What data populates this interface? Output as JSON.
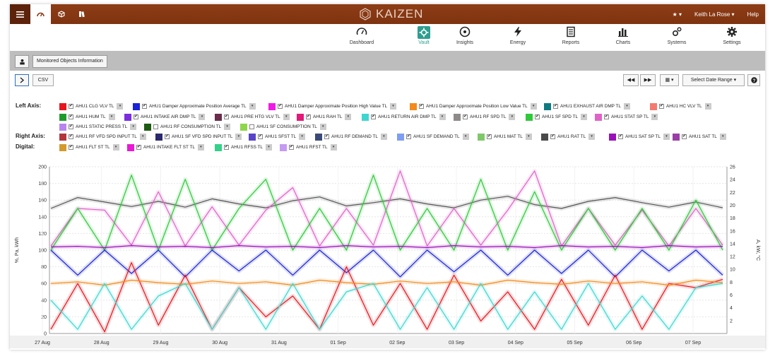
{
  "brand": {
    "name": "KAIZEN"
  },
  "topbar": {
    "user": "Keith La Rose",
    "help": "Help"
  },
  "nav": [
    {
      "label": "Dashboard",
      "icon": "gauge-icon"
    },
    {
      "label": "Vault",
      "icon": "gear-vault-icon",
      "active": true
    },
    {
      "label": "Insights",
      "icon": "insights-icon"
    },
    {
      "label": "Energy",
      "icon": "bolt-icon"
    },
    {
      "label": "Reports",
      "icon": "document-icon"
    },
    {
      "label": "Charts",
      "icon": "bar-chart-icon"
    },
    {
      "label": "Systems",
      "icon": "gears-icon"
    },
    {
      "label": "Settings",
      "icon": "cog-icon"
    }
  ],
  "strip": {
    "monitored": "Monitored Objects Information"
  },
  "toolbar": {
    "csv": "CSV",
    "date_range": "Select Date Range"
  },
  "legend": {
    "left_axis_label": "Left Axis:",
    "right_axis_label": "Right Axis:",
    "digital_label": "Digital:",
    "left": [
      {
        "name": "AHU1 CLG VLV TL",
        "color": "#e8141c",
        "checked": true
      },
      {
        "name": "AHU1 Damper Approximate Position Average TL",
        "color": "#1a23d6",
        "checked": true
      },
      {
        "name": "AHU1 Damper Approximate Position High Value TL",
        "color": "#f219e6",
        "checked": true
      },
      {
        "name": "AHU1 Damper Approximate Position Low Value TL",
        "color": "#f38a1c",
        "checked": true
      },
      {
        "name": "AHU1 EXHAUST AIR DMP TL",
        "color": "#0f7a82",
        "checked": true
      },
      {
        "name": "AHU1 HC VLV TL",
        "color": "#f47a70",
        "checked": true
      },
      {
        "name": "AHU1 HUM TL",
        "color": "#1f9b2c",
        "checked": true
      },
      {
        "name": "AHU1 INTAKE AIR DMP TL",
        "color": "#7b2ee0",
        "checked": true
      },
      {
        "name": "AHU1 PRE HTG VLV TL",
        "color": "#6a2d4a",
        "checked": true
      },
      {
        "name": "AHU1 RAH TL",
        "color": "#e21a78",
        "checked": true
      },
      {
        "name": "AHU1 RETURN AIR DMP TL",
        "color": "#3fd6cf",
        "checked": true
      },
      {
        "name": "AHU1 RF SPD TL",
        "color": "#8e8a8a",
        "checked": true
      },
      {
        "name": "AHU1 SF SPD TL",
        "color": "#2fc93a",
        "checked": true
      },
      {
        "name": "AHU1 STAT SP TL",
        "color": "#e063c7",
        "checked": true
      },
      {
        "name": "AHU1 STATIC PRESS TL",
        "color": "#b784f0",
        "checked": true
      },
      {
        "name": "AHU1 RF CONSUMPTION TL",
        "color": "#1d5a12",
        "checked": false
      },
      {
        "name": "AHU1 SF CONSUMPTION TL",
        "color": "#8fd64a",
        "checked": false
      }
    ],
    "right": [
      {
        "name": "AHU1 RF VFD SPD INPUT TL",
        "color": "#b3353c",
        "checked": true
      },
      {
        "name": "AHU1 SF VFD SPD INPUT TL",
        "color": "#2b2a6e",
        "checked": true
      },
      {
        "name": "AHU1 SFST TL",
        "color": "#5a44c8",
        "checked": true
      },
      {
        "name": "AHU1 RF DEMAND TL",
        "color": "#3a4a78",
        "checked": true
      },
      {
        "name": "AHU1 SF DEMAND TL",
        "color": "#7f9ef2",
        "checked": true
      },
      {
        "name": "AHU1 MAT TL",
        "color": "#7fc86a",
        "checked": true
      },
      {
        "name": "AHU1 RAT TL",
        "color": "#4a4a4a",
        "checked": true
      },
      {
        "name": "AHU1 SAT SP TL",
        "color": "#9a10b8",
        "checked": true
      },
      {
        "name": "AHU1 SAT TL",
        "color": "#9a3fa6",
        "checked": true
      }
    ],
    "digital": [
      {
        "name": "AHU1 FLT ST TL",
        "color": "#d49a2c",
        "checked": true
      },
      {
        "name": "AHU1 INTAKE FLT ST TL",
        "color": "#e91ad4",
        "checked": true
      },
      {
        "name": "AHU1 RFSS TL",
        "color": "#34d18a",
        "checked": true
      },
      {
        "name": "AHU1 RFST TL",
        "color": "#c49af2",
        "checked": true
      }
    ]
  },
  "chart_data": {
    "type": "line",
    "y_left_label": "%, Pa, kWh",
    "y_right_label": "A, kW, °C",
    "y_left_ticks": [
      0,
      20,
      40,
      60,
      80,
      100,
      120,
      140,
      160,
      180,
      200
    ],
    "y_right_ticks": [
      2,
      4,
      6,
      8,
      10,
      12,
      14,
      16,
      18,
      20,
      22,
      24,
      26
    ],
    "ylim_left": [
      0,
      200
    ],
    "ylim_right": [
      0,
      26
    ],
    "x_ticks": [
      "27 Aug",
      "28 Aug",
      "29 Aug",
      "30 Aug",
      "31 Aug",
      "01 Sep",
      "02 Sep",
      "03 Sep",
      "04 Sep",
      "05 Sep",
      "06 Sep",
      "07 Sep"
    ],
    "grid": true,
    "series": [
      {
        "name": "AHU1 RAT TL",
        "axis": "right",
        "color": "#555555",
        "values": [
          19.5,
          21.2,
          20.5,
          19.8,
          20.6,
          19.7,
          21.0,
          20.2,
          19.6,
          20.7,
          21.3,
          19.9,
          20.4,
          21.0,
          20.2,
          19.6,
          20.8,
          21.4,
          20.1,
          19.5,
          20.6,
          21.2,
          20.4,
          19.7,
          20.5,
          19.6
        ]
      },
      {
        "name": "AHU1 STAT SP TL",
        "axis": "left",
        "color": "#e063c7",
        "values": [
          105,
          150,
          148,
          106,
          170,
          105,
          152,
          106,
          148,
          175,
          105,
          150,
          106,
          195,
          105,
          150,
          106,
          148,
          195,
          105,
          150,
          106,
          148,
          105,
          150,
          106
        ]
      },
      {
        "name": "AHU1 SF SPD TL",
        "axis": "left",
        "color": "#2fc93a",
        "values": [
          100,
          150,
          100,
          190,
          100,
          185,
          100,
          150,
          185,
          100,
          150,
          100,
          190,
          100,
          150,
          100,
          185,
          100,
          170,
          100,
          150,
          100,
          150,
          100,
          160,
          100
        ]
      },
      {
        "name": "AHU1 Damper Approximate Position Average TL",
        "axis": "left",
        "color": "#1a23d6",
        "values": [
          100,
          70,
          100,
          72,
          100,
          68,
          100,
          75,
          100,
          70,
          100,
          73,
          100,
          68,
          100,
          74,
          100,
          70,
          100,
          72,
          100,
          68,
          100,
          75,
          100,
          70
        ]
      },
      {
        "name": "AHU1 CLG VLV TL",
        "axis": "left",
        "color": "#e8141c",
        "values": [
          5,
          60,
          2,
          85,
          10,
          70,
          5,
          55,
          20,
          45,
          5,
          80,
          10,
          60,
          5,
          70,
          15,
          50,
          5,
          65,
          10,
          70,
          5,
          60,
          55,
          65
        ]
      },
      {
        "name": "AHU1 Damper Approximate Position Low Value TL",
        "axis": "left",
        "color": "#f38a1c",
        "values": [
          60,
          62,
          58,
          64,
          61,
          59,
          63,
          60,
          62,
          58,
          64,
          61,
          59,
          63,
          60,
          62,
          58,
          64,
          61,
          59,
          63,
          60,
          62,
          58,
          64,
          61
        ]
      },
      {
        "name": "AHU1 RETURN AIR DMP TL",
        "axis": "left",
        "color": "#3fd6cf",
        "values": [
          40,
          5,
          60,
          5,
          45,
          60,
          5,
          55,
          5,
          60,
          5,
          50,
          60,
          5,
          55,
          5,
          60,
          5,
          50,
          5,
          60,
          5,
          45,
          5,
          55,
          60
        ]
      },
      {
        "name": "AHU1 SAT SP TL",
        "axis": "right",
        "color": "#9a10b8",
        "values": [
          13.5,
          13.6,
          13.4,
          13.7,
          13.5,
          13.6,
          13.4,
          13.7,
          13.5,
          13.6,
          13.4,
          13.7,
          13.5,
          13.6,
          13.4,
          13.7,
          13.5,
          13.6,
          13.4,
          13.7,
          13.5,
          13.6,
          13.4,
          13.7,
          13.5,
          13.6
        ]
      }
    ]
  }
}
